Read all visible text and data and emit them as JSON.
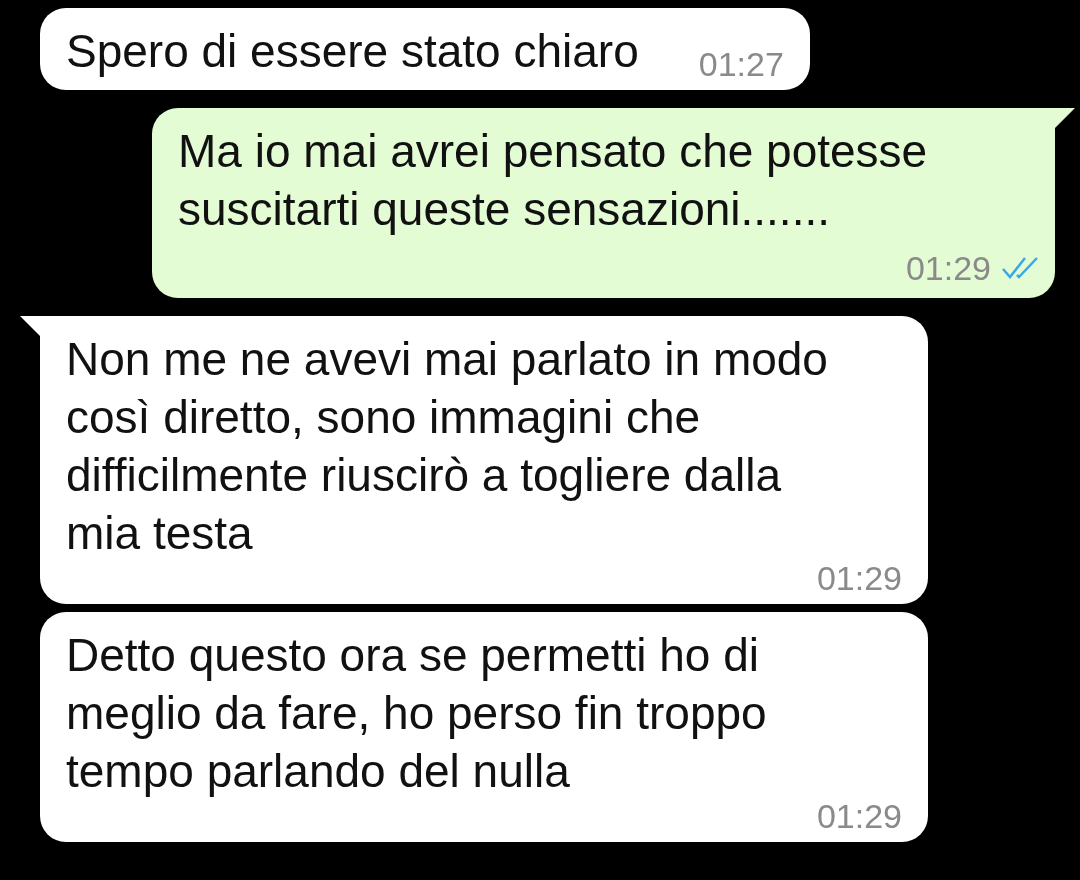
{
  "messages": [
    {
      "kind": "incoming",
      "tail": false,
      "text": "Spero di essere stato chiaro",
      "time": "01:27"
    },
    {
      "kind": "outgoing",
      "tail": true,
      "text": "Ma io mai avrei pensato che potesse suscitarti queste sensazioni.......",
      "time": "01:29",
      "read": true
    },
    {
      "kind": "incoming",
      "tail": true,
      "text": "Non me ne avevi mai parlato in modo così diretto, sono immagini che difficilmente riuscirò a togliere dalla mia testa",
      "time": "01:29"
    },
    {
      "kind": "incoming",
      "tail": false,
      "text": "Detto questo ora se permetti ho di meglio da fare, ho perso fin troppo tempo parlando del nulla",
      "time": "01:29"
    }
  ]
}
